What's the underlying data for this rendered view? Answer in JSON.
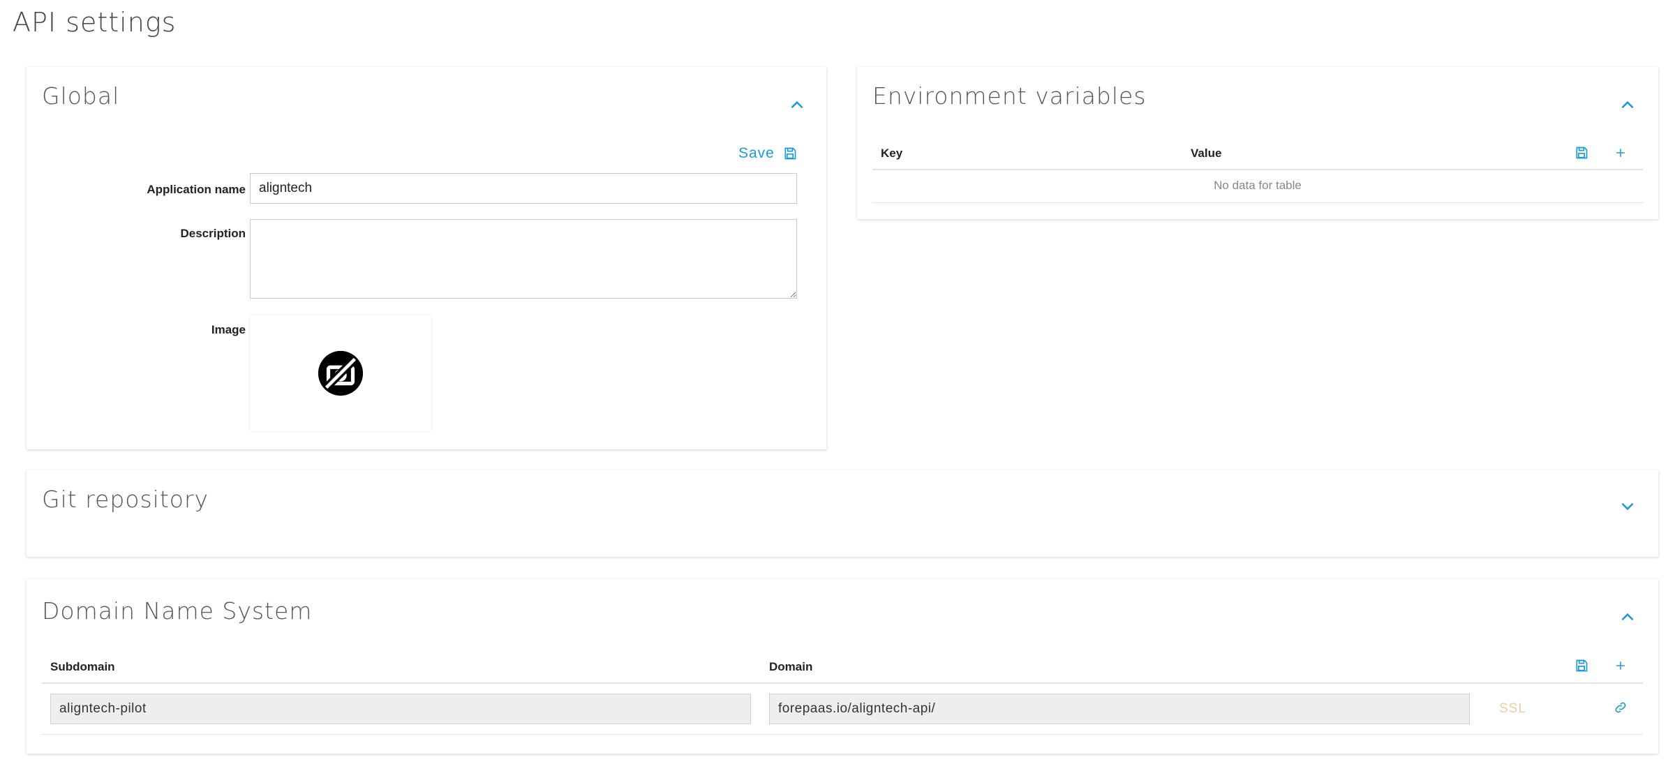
{
  "page": {
    "title": "API settings"
  },
  "global": {
    "title": "Global",
    "save_label": "Save",
    "fields": {
      "app_name_label": "Application name",
      "app_name_value": "aligntech",
      "description_label": "Description",
      "description_value": "",
      "image_label": "Image"
    }
  },
  "env": {
    "title": "Environment variables",
    "columns": [
      "Key",
      "Value"
    ],
    "empty_text": "No data for table"
  },
  "git": {
    "title": "Git repository"
  },
  "dns": {
    "title": "Domain Name System",
    "columns": [
      "Subdomain",
      "Domain"
    ],
    "rows": [
      {
        "subdomain": "aligntech-pilot",
        "domain": "forepaas.io/aligntech-api/",
        "ssl_label": "SSL"
      }
    ]
  },
  "colors": {
    "accent": "#1a9ad6",
    "ssl_disabled": "#e8cfa0"
  },
  "icons": {
    "collapse": "chevron-up-icon",
    "expand": "chevron-down-icon",
    "save": "floppy-disk-icon",
    "add": "plus-icon",
    "link": "link-icon",
    "no_image": "no-image-icon"
  }
}
